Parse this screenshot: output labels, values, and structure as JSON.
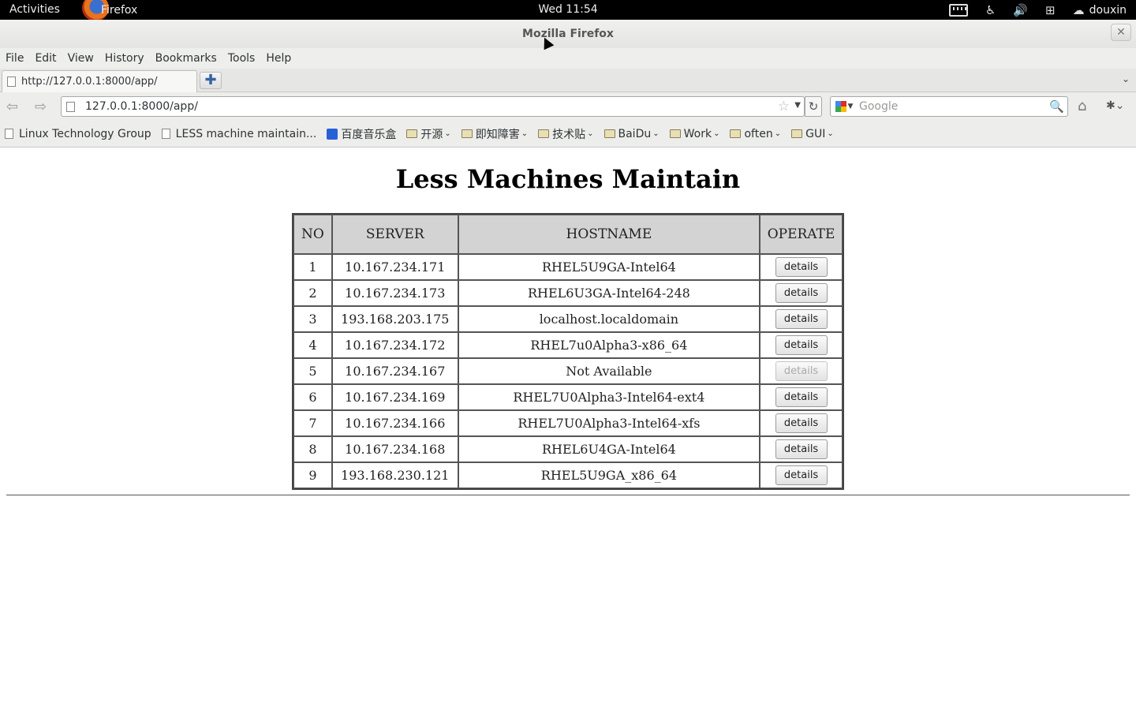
{
  "top_panel": {
    "activities": "Activities",
    "app_name": "Firefox",
    "clock": "Wed 11:54",
    "user": "douxin"
  },
  "window": {
    "title": "Mozilla Firefox",
    "close_glyph": "✕"
  },
  "menu": [
    "File",
    "Edit",
    "View",
    "History",
    "Bookmarks",
    "Tools",
    "Help"
  ],
  "tabs": [
    {
      "label": "http://127.0.0.1:8000/app/"
    }
  ],
  "navbar": {
    "url": "127.0.0.1:8000/app/",
    "search_placeholder": "Google"
  },
  "bookmarks": [
    {
      "label": "Linux Technology Group",
      "type": "page"
    },
    {
      "label": "LESS machine maintain...",
      "type": "page"
    },
    {
      "label": "百度音乐盒",
      "type": "baidu"
    },
    {
      "label": "开源",
      "type": "folder"
    },
    {
      "label": "即知障害",
      "type": "folder"
    },
    {
      "label": "技术贴",
      "type": "folder"
    },
    {
      "label": "BaiDu",
      "type": "folder"
    },
    {
      "label": "Work",
      "type": "folder"
    },
    {
      "label": "often",
      "type": "folder"
    },
    {
      "label": "GUI",
      "type": "folder"
    }
  ],
  "page": {
    "heading": "Less Machines Maintain",
    "columns": [
      "NO",
      "SERVER",
      "HOSTNAME",
      "OPERATE"
    ],
    "button_label": "details",
    "rows": [
      {
        "no": "1",
        "server": "10.167.234.171",
        "hostname": "RHEL5U9GA-Intel64",
        "enabled": true
      },
      {
        "no": "2",
        "server": "10.167.234.173",
        "hostname": "RHEL6U3GA-Intel64-248",
        "enabled": true
      },
      {
        "no": "3",
        "server": "193.168.203.175",
        "hostname": "localhost.localdomain",
        "enabled": true
      },
      {
        "no": "4",
        "server": "10.167.234.172",
        "hostname": "RHEL7u0Alpha3-x86_64",
        "enabled": true
      },
      {
        "no": "5",
        "server": "10.167.234.167",
        "hostname": "Not Available",
        "enabled": false
      },
      {
        "no": "6",
        "server": "10.167.234.169",
        "hostname": "RHEL7U0Alpha3-Intel64-ext4",
        "enabled": true
      },
      {
        "no": "7",
        "server": "10.167.234.166",
        "hostname": "RHEL7U0Alpha3-Intel64-xfs",
        "enabled": true
      },
      {
        "no": "8",
        "server": "10.167.234.168",
        "hostname": "RHEL6U4GA-Intel64",
        "enabled": true
      },
      {
        "no": "9",
        "server": "193.168.230.121",
        "hostname": "RHEL5U9GA_x86_64",
        "enabled": true
      }
    ]
  }
}
